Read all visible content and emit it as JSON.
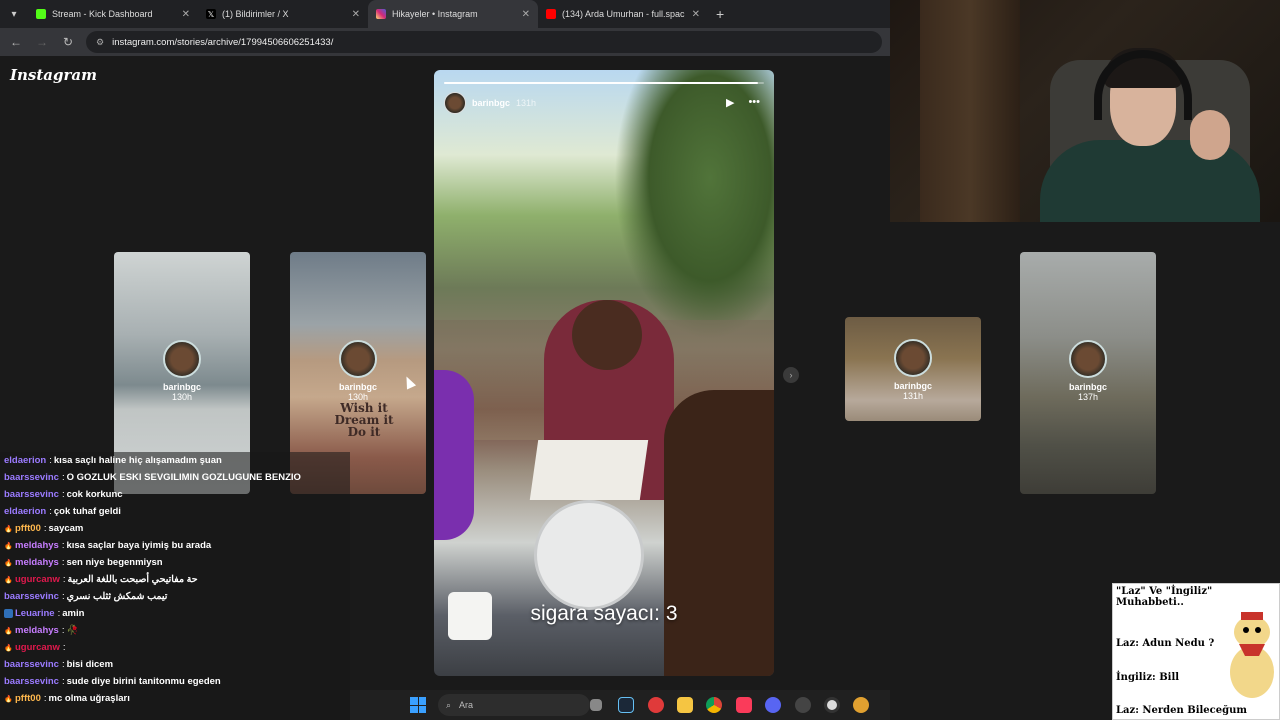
{
  "browser": {
    "tabs": [
      {
        "label": "Stream - Kick Dashboard",
        "color": "#53fc18"
      },
      {
        "label": "(1) Bildirimler / X",
        "color": "#000000"
      },
      {
        "label": "Hikayeler • Instagram",
        "color": "#e1306c"
      },
      {
        "label": "(134) Arda Umurhan - full.spac",
        "color": "#ff0000"
      }
    ],
    "url": "instagram.com/stories/archive/17994506606251433/"
  },
  "instagram": {
    "logo": "Instagram",
    "main_story": {
      "username": "barinbgc",
      "time": "131h",
      "caption": "sigara sayacı: 3",
      "progress": 0.98
    },
    "thumbnails": [
      {
        "username": "barinbgc",
        "time": "130h"
      },
      {
        "username": "barinbgc",
        "time": "130h",
        "mug_text": "Wish it Dream it Do it"
      },
      {
        "username": "barinbgc",
        "time": "131h"
      },
      {
        "username": "barinbgc",
        "time": "137h"
      }
    ]
  },
  "chat": [
    {
      "user": "eldaerion",
      "color": "#9b7bff",
      "msg": "kısa saçlı haline hiç alışamadım şuan",
      "badge": ""
    },
    {
      "user": "baarssevinc",
      "color": "#9b7bff",
      "msg": "O GOZLUK ESKI SEVGILIMIN GOZLUGUNE BENZIO",
      "badge": ""
    },
    {
      "user": "baarssevinc",
      "color": "#9b7bff",
      "msg": "cok korkunc",
      "badge": ""
    },
    {
      "user": "eldaerion",
      "color": "#9b7bff",
      "msg": "çok tuhaf geldi",
      "badge": ""
    },
    {
      "user": "pfft00",
      "color": "#ffb84d",
      "msg": "saycam",
      "badge": "fire"
    },
    {
      "user": "meldahys",
      "color": "#c77dff",
      "msg": "kısa saçlar baya iyimiş bu arada",
      "badge": "fire"
    },
    {
      "user": "meldahys",
      "color": "#c77dff",
      "msg": "sen niye begenmiysn",
      "badge": "fire"
    },
    {
      "user": "ugurcanw",
      "color": "#e0194d",
      "msg": "حة مفاتيحي أصبحت باللغة العربية",
      "badge": "fire"
    },
    {
      "user": "baarssevinc",
      "color": "#9b7bff",
      "msg": "تيمب شمكش ثثلب نسري",
      "badge": ""
    },
    {
      "user": "Leuarine",
      "color": "#9b7bff",
      "msg": "amin",
      "badge": "sub"
    },
    {
      "user": "meldahys",
      "color": "#c77dff",
      "msg": "🥀",
      "badge": "fire"
    },
    {
      "user": "ugurcanw",
      "color": "#e0194d",
      "msg": "",
      "badge": "fire"
    },
    {
      "user": "baarssevinc",
      "color": "#9b7bff",
      "msg": "bisi dicem",
      "badge": ""
    },
    {
      "user": "baarssevinc",
      "color": "#9b7bff",
      "msg": "sude diye birini tanitonmu egeden",
      "badge": ""
    },
    {
      "user": "pfft00",
      "color": "#ffb84d",
      "msg": "mc olma uğraşları",
      "badge": "fire"
    }
  ],
  "taskbar": {
    "search_placeholder": "Ara"
  },
  "meme": {
    "title": "\"Laz\" Ve \"İngiliz\" Muhabbeti..",
    "lines": [
      "Laz: Adun Nedu ?",
      "İngiliz: Bill",
      "Laz: Nerden Bileceğum"
    ]
  }
}
